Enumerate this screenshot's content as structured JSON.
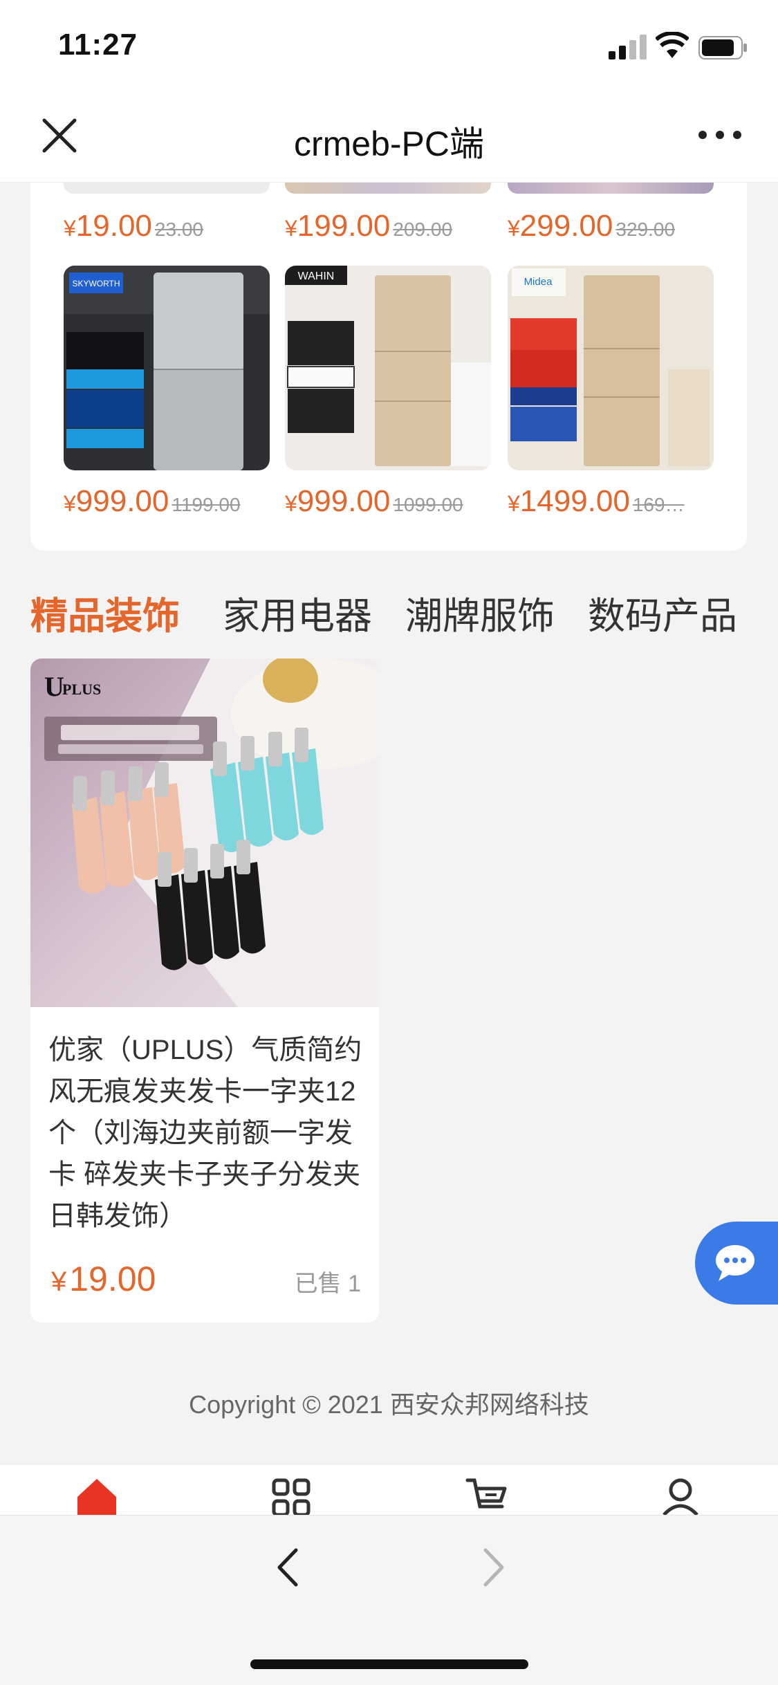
{
  "status_bar": {
    "time": "11:27"
  },
  "nav": {
    "title": "crmeb-PC端"
  },
  "top_row_prices": [
    {
      "price": "19.00",
      "original": "23.00"
    },
    {
      "price": "199.00",
      "original": "209.00"
    },
    {
      "price": "299.00",
      "original": "329.00"
    }
  ],
  "fridge_products": [
    {
      "brand": "SKYWORTH",
      "price": "999.00",
      "original": "1199.00"
    },
    {
      "brand": "WAHIN",
      "price": "999.00",
      "original": "1099.00"
    },
    {
      "brand": "Midea",
      "price": "1499.00",
      "original": "169…"
    }
  ],
  "currency_symbol": "¥",
  "tabs": [
    "精品装饰",
    "家用电器",
    "潮牌服饰",
    "数码产品"
  ],
  "active_tab": 0,
  "featured": {
    "name": "优家（UPLUS）气质简约风无痕发夹发卡一字夹12个（刘海边夹前额一字发卡 碎发夹卡子夹子分发夹 日韩发饰）",
    "price": "19.00",
    "sold": "已售 1"
  },
  "footer": {
    "copyright": "Copyright © 2021 西安众邦网络科技"
  },
  "colors": {
    "accent": "#e4662b",
    "chat": "#3a7be8"
  },
  "icons": [
    "close-icon",
    "more-icon",
    "chat-icon",
    "home-icon",
    "grid-icon",
    "cart-icon",
    "user-icon",
    "back-arrow-icon",
    "forward-arrow-icon"
  ]
}
